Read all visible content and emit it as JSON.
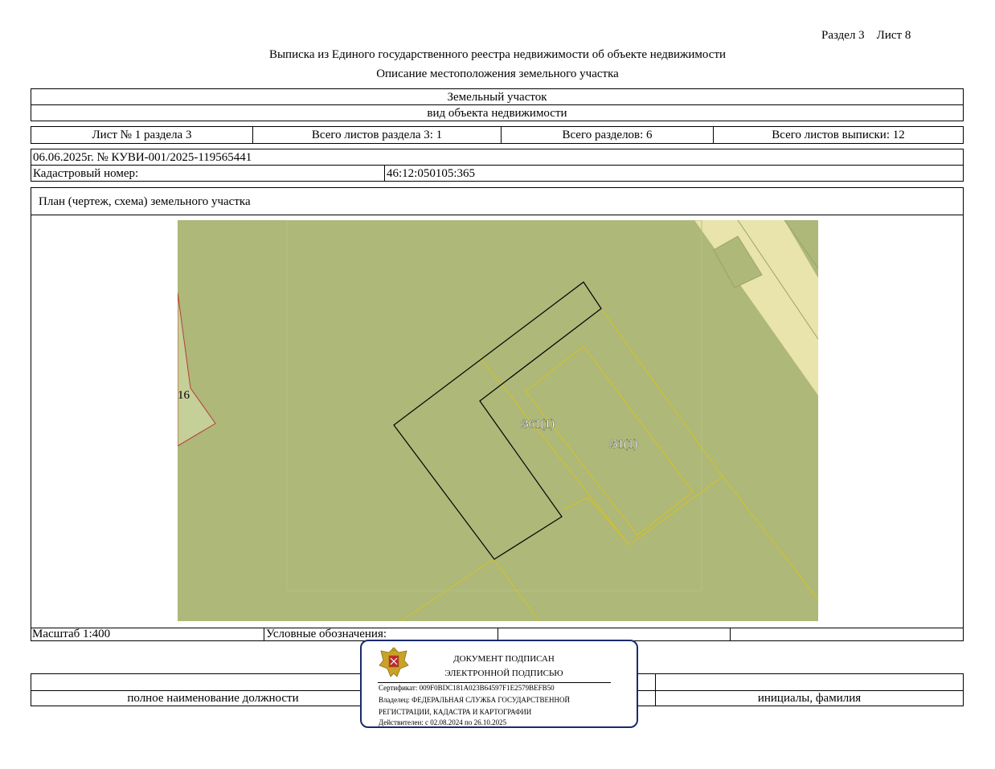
{
  "header": {
    "section_sheet": "Раздел 3    Лист 8",
    "title": "Выписка из Единого государственного реестра недвижимости об объекте недвижимости",
    "subtitle": "Описание местоположения земельного участка"
  },
  "object": {
    "type": "Земельный участок",
    "type_caption": "вид объекта недвижимости"
  },
  "sheets": {
    "sheet": "Лист № 1 раздела 3",
    "total_sheets_section": "Всего листов раздела 3: 1",
    "total_sections": "Всего разделов: 6",
    "total_sheets_extract": "Всего листов выписки: 12"
  },
  "doc": {
    "date_number": "06.06.2025г. № КУВИ-001/2025-119565441",
    "cadastral_label": "Кадастровый номер:",
    "cadastral_value": "46:12:050105:365"
  },
  "plan": {
    "title": "План (чертеж, схема) земельного участка",
    "labels": {
      "left_parcel": "16",
      "parcel_361": ":361(1)",
      "parcel_51": ":51(1)"
    },
    "colors": {
      "background": "#adb879",
      "neighbor_parcel": "#c5cf98",
      "road": "#e9e3ac",
      "yellow_line": "#d9c21c",
      "red_line": "#b4403a"
    }
  },
  "footer": {
    "scale": "Масштаб 1:400",
    "legend_label": "Условные обозначения:",
    "position_caption": "полное наименование должности",
    "name_caption": "инициалы, фамилия"
  },
  "stamp": {
    "line1": "ДОКУМЕНТ ПОДПИСАН",
    "line2": "ЭЛЕКТРОННОЙ ПОДПИСЬЮ",
    "certificate": "Сертификат: 009F0BDC181A023B64597F1E2579BEFB50",
    "owner1": "Владелец: ФЕДЕРАЛЬНАЯ СЛУЖБА ГОСУДАРСТВЕННОЙ",
    "owner2": "РЕГИСТРАЦИИ, КАДАСТРА И КАРТОГРАФИИ",
    "valid": "Действителен: с 02.08.2024 по 26.10.2025"
  }
}
